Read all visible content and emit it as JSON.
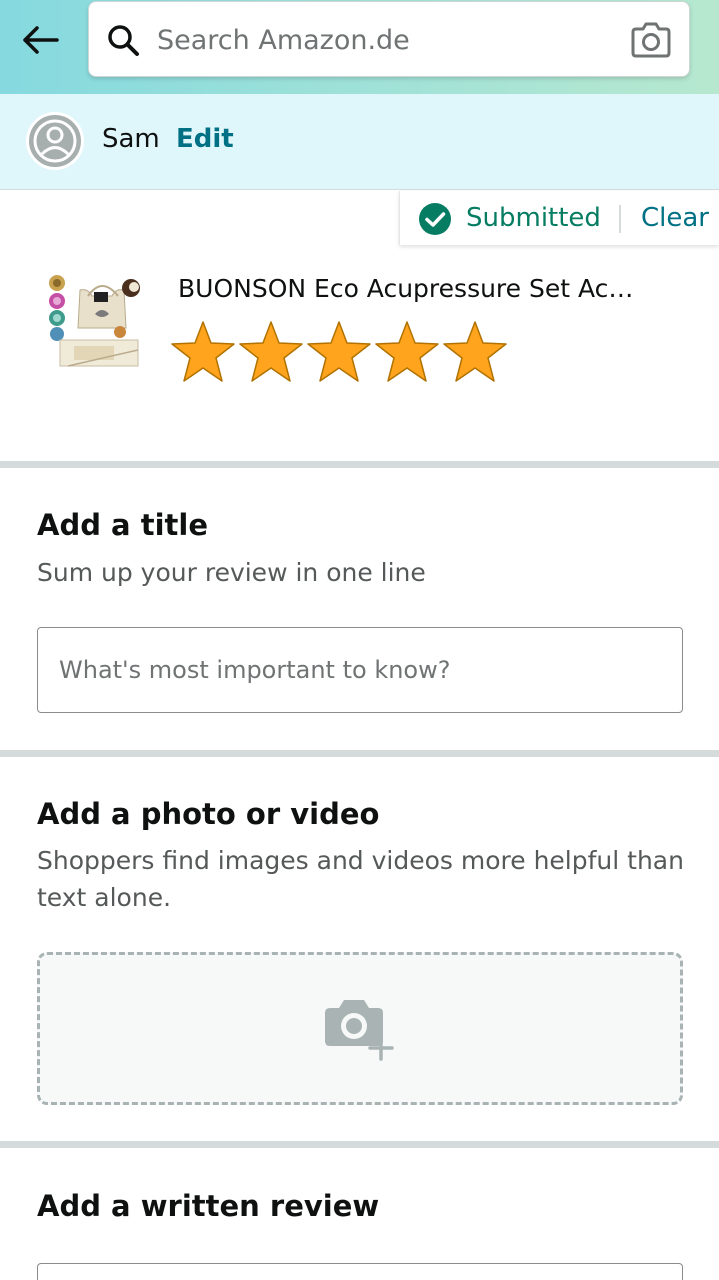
{
  "header": {
    "search_placeholder": "Search Amazon.de",
    "back_icon": "arrow-left-icon",
    "search_icon": "magnifier-icon",
    "camera_icon": "camera-icon"
  },
  "user": {
    "name": "Sam",
    "edit_label": "Edit"
  },
  "status": {
    "submitted_label": "Submitted",
    "clear_label": "Clear"
  },
  "product": {
    "name": "BUONSON Eco Acupressure Set Ac…",
    "rating": 5,
    "max_rating": 5
  },
  "title_section": {
    "heading": "Add a title",
    "subtitle": "Sum up your review in one line",
    "placeholder": "What's most important to know?"
  },
  "photo_section": {
    "heading": "Add a photo or video",
    "subtitle": "Shoppers find images and videos more helpful than text alone."
  },
  "review_section": {
    "heading": "Add a written review"
  },
  "colors": {
    "accent_link": "#007185",
    "success": "#067d62",
    "star": "#ffa41c",
    "header_gradient_start": "#85d9df",
    "header_gradient_end": "#b7e8cf",
    "user_bar_bg": "#dff6fb"
  }
}
